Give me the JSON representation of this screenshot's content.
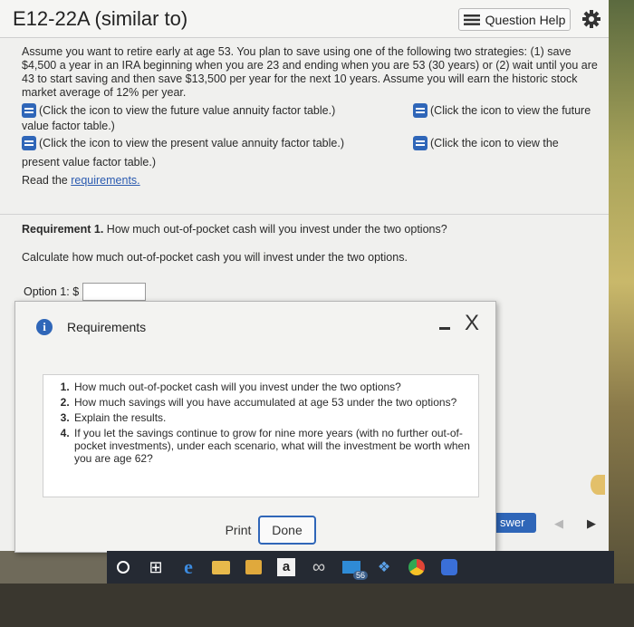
{
  "header": {
    "title": "E12-22A (similar to)",
    "question_help_label": "Question Help"
  },
  "problem": {
    "text": "Assume you want to retire early at age 53. You plan to save using one of the following two strategies: (1) save $4,500 a year in an IRA beginning when you are 23 and ending when you are 53 (30 years) or (2) wait until you are 43 to start saving and then save $13,500 per year for the next 10 years. Assume you will earn the historic stock market average of 12% per year.",
    "link_fv_annuity": "(Click the icon to view the future value annuity factor table.)",
    "link_fv_factor_a": "(Click the icon to view the future",
    "link_fv_factor_b": "value factor table.)",
    "link_pv_annuity": "(Click the icon to view the present value annuity factor table.)",
    "link_pv_factor_a": "(Click the icon to view the",
    "link_pv_factor_b": "present value factor table.)",
    "read_the": "Read the",
    "requirements_link": "requirements."
  },
  "requirement1": {
    "label": "Requirement 1.",
    "question": "How much out-of-pocket cash will you invest under the two options?",
    "instruction": "Calculate how much out-of-pocket cash you will invest under the two options.",
    "option1_label": "Option 1: $",
    "option1_value": ""
  },
  "modal": {
    "title": "Requirements",
    "minimize_glyph": "–",
    "close_glyph": "X",
    "items": [
      "How much out-of-pocket cash will you invest under the two options?",
      "How much savings will you have accumulated at age 53 under the two options?",
      "Explain the results.",
      "If you let the savings continue to grow for nine more years (with no further out-of-pocket investments), under each scenario, what will the investment be worth when you are age 62?"
    ],
    "print_label": "Print",
    "done_label": "Done"
  },
  "footer": {
    "answer_label": "swer",
    "prev_glyph": "◀",
    "next_glyph": "▶"
  },
  "taskbar": {
    "amazon_letter": "a",
    "edge_letter": "e",
    "infinity_glyph": "∞",
    "mail_badge": "56",
    "taskview_glyph": "⊞",
    "dropbox_glyph": "❖"
  },
  "colors": {
    "accent": "#2f66b8",
    "taskbar": "#252a33"
  }
}
